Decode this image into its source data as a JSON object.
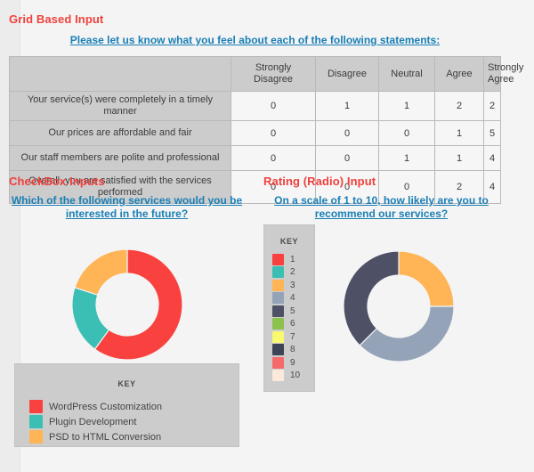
{
  "colors": {
    "heading_red": "#f0403c",
    "link_blue": "#1a7fb5",
    "page_bg": "#f4f4f4",
    "table_header_bg": "#cccccc",
    "table_cell_bg": "#f6f6f6",
    "series_red": "#f9423f",
    "series_teal": "#3bbfb5",
    "series_orange": "#ffb455",
    "series_bluegray": "#94a3b8",
    "series_navy": "#4e5166",
    "series_green": "#8cc14c",
    "series_yellow": "#f9f871",
    "series_slate": "#3c4456",
    "series_pink": "#f76a6a",
    "series_cream": "#fbe9dc"
  },
  "grid": {
    "title": "Grid Based Input",
    "question": "Please let us know what you feel about each of the following statements:",
    "corner_header": "",
    "columns": [
      "Strongly Disagree",
      "Disagree",
      "Neutral",
      "Agree",
      "Strongly Agree"
    ],
    "rows": [
      {
        "label": "Your service(s) were completely in a timely manner",
        "values": [
          "0",
          "1",
          "1",
          "2",
          "2"
        ]
      },
      {
        "label": "Our prices are affordable and fair",
        "values": [
          "0",
          "0",
          "0",
          "1",
          "5"
        ]
      },
      {
        "label": "Our staff members are polite and professional",
        "values": [
          "0",
          "0",
          "1",
          "1",
          "4"
        ]
      },
      {
        "label": "Overall, you are satisfied with the services performed",
        "values": [
          "0",
          "0",
          "0",
          "2",
          "4"
        ]
      }
    ]
  },
  "checkbox": {
    "title": "CheckBox Inputs",
    "question": "Which of the following services would you be interested in the future?",
    "key_title": "KEY",
    "legend": [
      {
        "label": "WordPress Customization",
        "color": "#f9423f"
      },
      {
        "label": "Plugin Development",
        "color": "#3bbfb5"
      },
      {
        "label": "PSD to HTML Conversion",
        "color": "#ffb455"
      }
    ]
  },
  "rating": {
    "title": "Rating (Radio) Input",
    "question": "On a scale of 1 to 10, how likely are you to recommend our services?",
    "key_title": "KEY",
    "legend": [
      {
        "label": "1",
        "color": "#f9423f"
      },
      {
        "label": "2",
        "color": "#3bbfb5"
      },
      {
        "label": "3",
        "color": "#ffb455"
      },
      {
        "label": "4",
        "color": "#94a3b8"
      },
      {
        "label": "5",
        "color": "#4e5166"
      },
      {
        "label": "6",
        "color": "#8cc14c"
      },
      {
        "label": "7",
        "color": "#f9f871"
      },
      {
        "label": "8",
        "color": "#3c4456"
      },
      {
        "label": "9",
        "color": "#f76a6a"
      },
      {
        "label": "10",
        "color": "#fbe9dc"
      }
    ]
  },
  "chart_data": [
    {
      "type": "pie",
      "id": "checkbox-donut",
      "title": "Which of the following services would you be interested in the future?",
      "donut": true,
      "legend_position": "bottom",
      "labels": [
        "WordPress Customization",
        "Plugin Development",
        "PSD to HTML Conversion"
      ],
      "values": [
        60,
        20,
        20
      ],
      "colors": [
        "#f9423f",
        "#3bbfb5",
        "#ffb455"
      ]
    },
    {
      "type": "pie",
      "id": "rating-donut",
      "title": "On a scale of 1 to 10, how likely are you to recommend our services?",
      "donut": true,
      "legend_position": "left",
      "labels": [
        "3",
        "4",
        "5"
      ],
      "values": [
        25,
        37.5,
        37.5
      ],
      "colors": [
        "#ffb455",
        "#94a3b8",
        "#4e5166"
      ]
    }
  ]
}
